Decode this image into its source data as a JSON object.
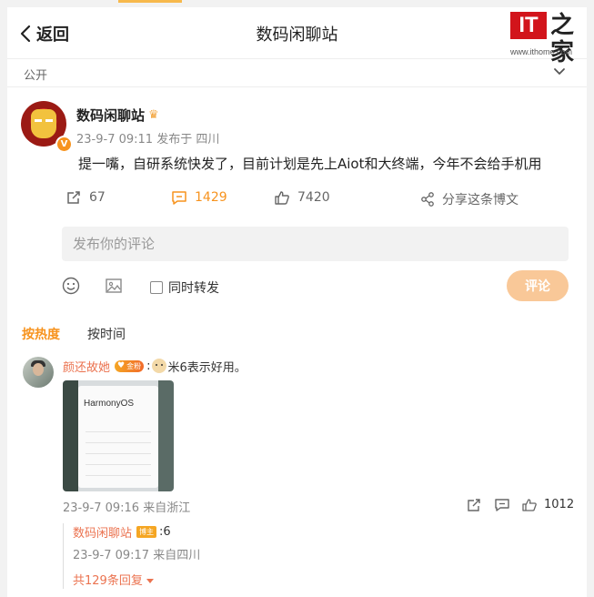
{
  "nav": {
    "back_label": "返回",
    "title": "数码闲聊站"
  },
  "watermark": {
    "logo_text": "IT",
    "logo_char": "之家",
    "url": "www.ithome.com"
  },
  "visibility": {
    "label": "公开"
  },
  "post": {
    "author": "数码闲聊站",
    "verified_badge": "V",
    "time": "23-9-7 09:11",
    "location": "发布于 四川",
    "content": "提一嘴，自研系统快发了，目前计划是先上Aiot和大终端，今年不会给手机用",
    "reposts": "67",
    "comments": "1429",
    "likes": "7420",
    "share_label": "分享这条博文"
  },
  "composer": {
    "placeholder": "发布你的评论",
    "repost_label": "同时转发",
    "submit_label": "评论"
  },
  "sort": {
    "hot": "按热度",
    "time": "按时间"
  },
  "comment": {
    "user": "颜还故她",
    "fan_badge": "金粉",
    "separator": ":",
    "text": "米6表示好用。",
    "image_brand": "HarmonyOS",
    "time": "23-9-7 09:16",
    "location": "来自浙江",
    "likes": "1012",
    "reply": {
      "user": "数码闲聊站",
      "badge": "博主",
      "text": ":6",
      "time": "23-9-7 09:17",
      "location": "来自四川",
      "more": "共129条回复"
    }
  },
  "colors": {
    "accent": "#f7931e",
    "link": "#eb7350",
    "brand_red": "#d2141b"
  }
}
